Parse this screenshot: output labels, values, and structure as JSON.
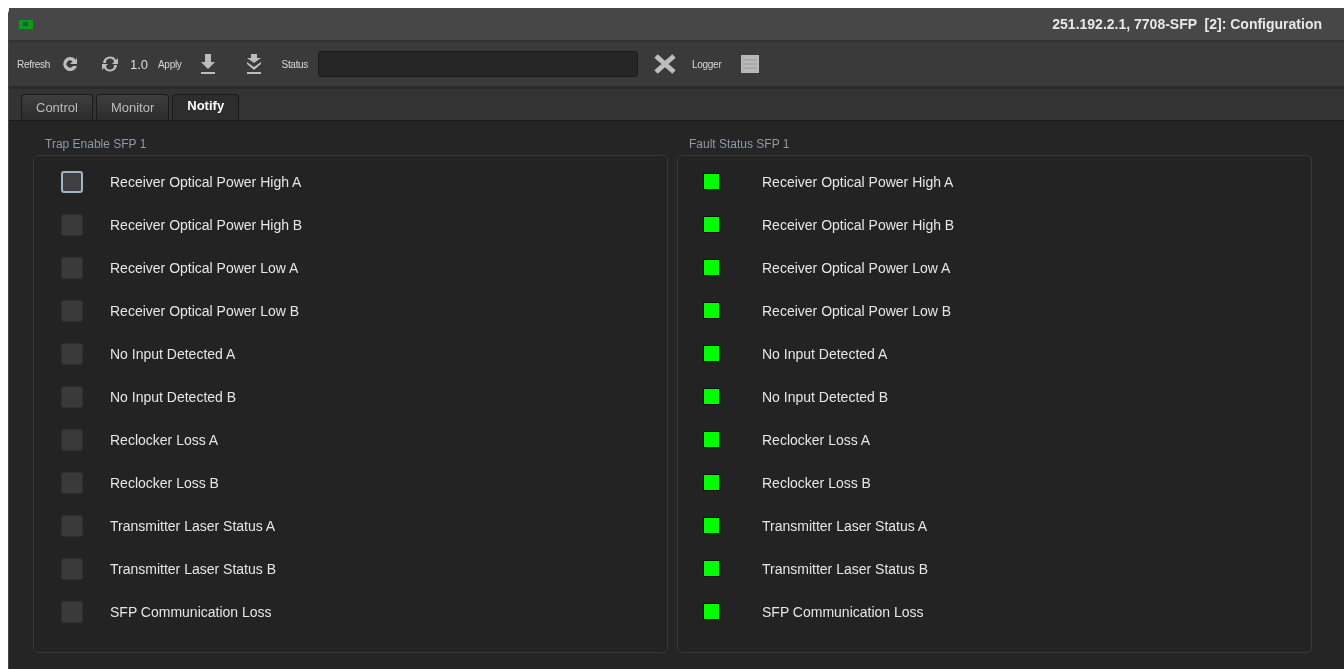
{
  "window": {
    "title": "251.192.2.1, 7708-SFP  [2]: Configuration"
  },
  "toolbar": {
    "refresh_label": "Refresh",
    "version": "1.0",
    "apply_label": "Apply",
    "status_label": "Status",
    "logger_label": "Logger"
  },
  "tabs": [
    {
      "label": "Control",
      "selected": false
    },
    {
      "label": "Monitor",
      "selected": false
    },
    {
      "label": "Notify",
      "selected": true
    }
  ],
  "trap_enable": {
    "title": "Trap Enable SFP 1",
    "items": [
      {
        "label": "Receiver Optical Power High A",
        "checked": false,
        "focused": true
      },
      {
        "label": "Receiver Optical Power High B",
        "checked": false,
        "focused": false
      },
      {
        "label": "Receiver Optical Power Low A",
        "checked": false,
        "focused": false
      },
      {
        "label": "Receiver Optical Power Low B",
        "checked": false,
        "focused": false
      },
      {
        "label": "No Input Detected A",
        "checked": false,
        "focused": false
      },
      {
        "label": "No Input Detected B",
        "checked": false,
        "focused": false
      },
      {
        "label": "Reclocker Loss A",
        "checked": false,
        "focused": false
      },
      {
        "label": "Reclocker Loss B",
        "checked": false,
        "focused": false
      },
      {
        "label": "Transmitter Laser Status A",
        "checked": false,
        "focused": false
      },
      {
        "label": "Transmitter Laser Status B",
        "checked": false,
        "focused": false
      },
      {
        "label": "SFP Communication Loss",
        "checked": false,
        "focused": false
      }
    ]
  },
  "fault_status": {
    "title": "Fault Status SFP 1",
    "items": [
      {
        "label": "Receiver Optical Power High A",
        "color": "#00ff00"
      },
      {
        "label": "Receiver Optical Power High B",
        "color": "#00ff00"
      },
      {
        "label": "Receiver Optical Power Low A",
        "color": "#00ff00"
      },
      {
        "label": "Receiver Optical Power Low B",
        "color": "#00ff00"
      },
      {
        "label": "No Input Detected A",
        "color": "#00ff00"
      },
      {
        "label": "No Input Detected B",
        "color": "#00ff00"
      },
      {
        "label": "Reclocker Loss A",
        "color": "#00ff00"
      },
      {
        "label": "Reclocker Loss B",
        "color": "#00ff00"
      },
      {
        "label": "Transmitter Laser Status A",
        "color": "#00ff00"
      },
      {
        "label": "Transmitter Laser Status B",
        "color": "#00ff00"
      },
      {
        "label": "SFP Communication Loss",
        "color": "#00ff00"
      }
    ]
  }
}
